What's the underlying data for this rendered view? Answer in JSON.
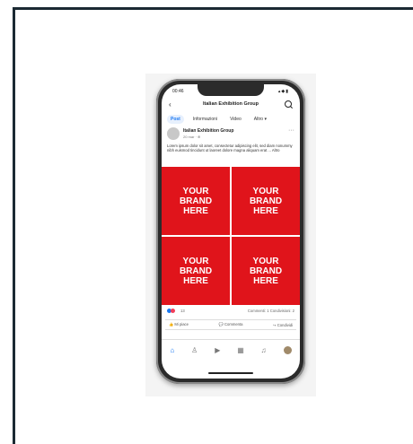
{
  "status": {
    "time": "00:46",
    "icons": "▴◆▮"
  },
  "appbar": {
    "back": "‹",
    "title": "Italian Exhibition Group"
  },
  "tabs": [
    {
      "label": "Post"
    },
    {
      "label": "Informazioni"
    },
    {
      "label": "Video"
    },
    {
      "label": "Altro ▾"
    }
  ],
  "post": {
    "author": "Italian Exhibition Group",
    "meta": "20 mar · ⊕",
    "more": "···",
    "text": "Lorem ipsum dolor sit amet, consectetur adipiscing elit, sed diam nonummy nibh euismod tincidunt ut laoreet dolore magna aliquam erat ... Altro",
    "tiles": [
      "YOUR\nBRAND\nHERE",
      "YOUR\nBRAND\nHERE",
      "YOUR\nBRAND\nHERE",
      "YOUR\nBRAND\nHERE"
    ]
  },
  "reactions": {
    "count": "13",
    "right": "Commenti: 1   Condivisioni: 2"
  },
  "actions": {
    "like": "👍 Mi piace",
    "comment": "💬 Commenta",
    "share": "↪ Condividi"
  },
  "colors": {
    "brand_tile": "#e0141b",
    "accent": "#1877f2",
    "frame": "#1b2a33"
  },
  "nav_icons": [
    "home-icon",
    "friends-icon",
    "watch-icon",
    "marketplace-icon",
    "notifications-icon",
    "profile-icon"
  ]
}
